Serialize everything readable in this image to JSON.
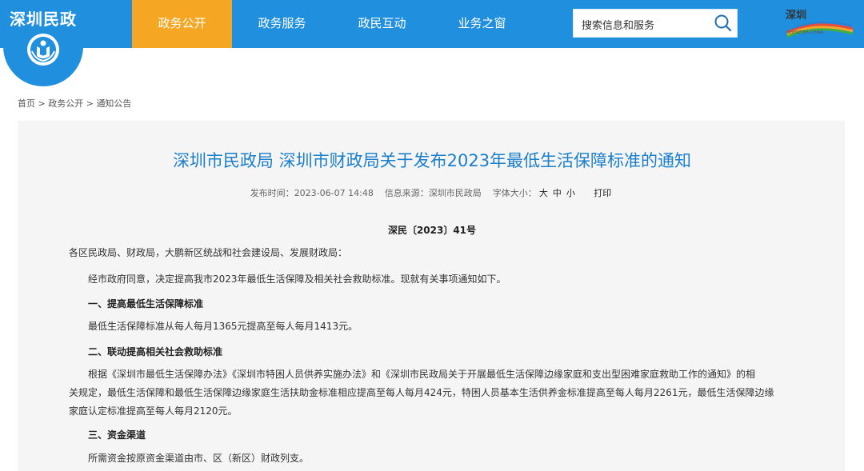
{
  "header": {
    "logo_text": "深圳民政",
    "nav": [
      "政务公开",
      "政务服务",
      "政民互动",
      "业务之窗"
    ],
    "search_placeholder": "搜索信息和服务",
    "brand_cn": "深圳",
    "brand_en": "SHENZHEN CHINA",
    "colors": {
      "primary": "#1f8fde",
      "active": "#f5a623"
    }
  },
  "breadcrumb": {
    "home": "首页",
    "sep": " > ",
    "section": "政务公开",
    "current": "通知公告"
  },
  "article": {
    "title": "深圳市民政局 深圳市财政局关于发布2023年最低生活保障标准的通知",
    "publish_label": "发布时间：",
    "publish_time": "2023-06-07 14:48",
    "source_label": "信息来源：",
    "source": "深圳市民政局",
    "font_label": "字体大小：",
    "font_sizes": [
      "大",
      "中",
      "小"
    ],
    "print": "打印",
    "doc_no": "深民〔2023〕41号",
    "addressee": "各区民政局、财政局，大鹏新区统战和社会建设局、发展财政局：",
    "intro": "经市政府同意，决定提高我市2023年最低生活保障及相关社会救助标准。现就有关事项通知如下。",
    "h1": "一、提高最低生活保障标准",
    "p1": "最低生活保障标准从每人每月1365元提高至每人每月1413元。",
    "h2": "二、联动提高相关社会救助标准",
    "p2_l1": "根据《深圳市最低生活保障办法》《深圳市特困人员供养实施办法》和《深圳市民政局关于开展最低生活保障边缘家庭和支出型困难家庭救助工作的通知》的相",
    "p2_l2": "关规定，最低生活保障和最低生活保障边缘家庭生活扶助金标准相应提高至每人每月424元，特困人员基本生活供养金标准提高至每人每月2261元，最低生活保障边缘",
    "p2_l3": "家庭认定标准提高至每人每月2120元。",
    "h3": "三、资金渠道",
    "p3": "所需资金按原资金渠道由市、区（新区）财政列支。"
  }
}
